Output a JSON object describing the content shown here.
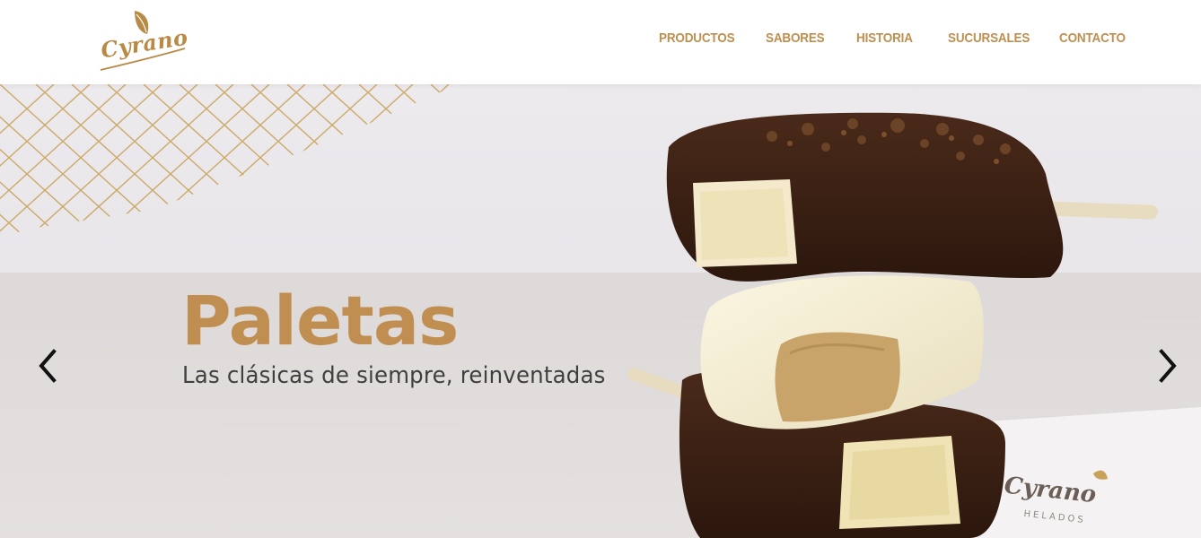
{
  "header": {
    "logo_text": "Cyrano",
    "nav": [
      {
        "label": "PRODUCTOS",
        "name": "nav-productos"
      },
      {
        "label": "SABORES",
        "name": "nav-sabores"
      },
      {
        "label": "HISTORIA",
        "name": "nav-historia"
      },
      {
        "label": "SUCURSALES",
        "name": "nav-sucursales"
      },
      {
        "label": "CONTACTO",
        "name": "nav-contacto"
      }
    ]
  },
  "hero": {
    "title": "Paletas",
    "subtitle": "Las clásicas de siempre, reinventadas",
    "prev_icon": "chevron-left-icon",
    "next_icon": "chevron-right-icon",
    "wrapper_brand": "Cyrano",
    "wrapper_sub": "HELADOS"
  },
  "colors": {
    "brand_gold": "#c18e52",
    "nav_gold": "#bf8f4f",
    "subtitle": "#3f3f3f",
    "header_bg": "#ffffff"
  }
}
